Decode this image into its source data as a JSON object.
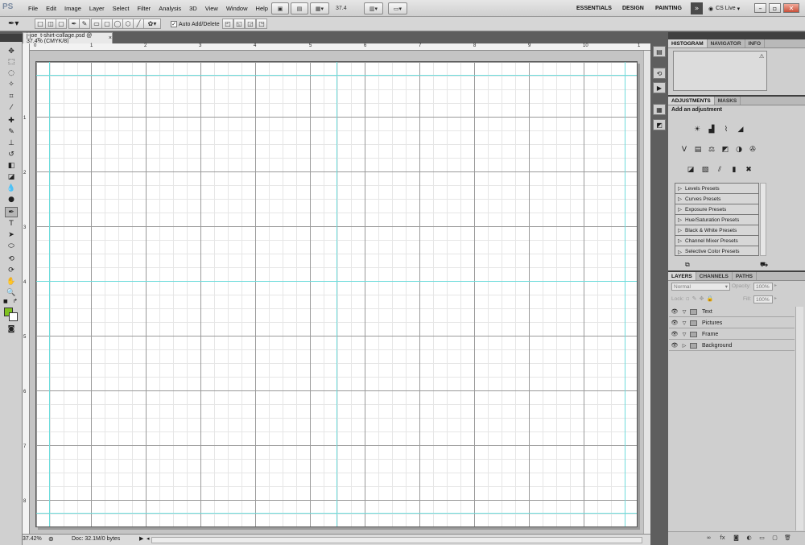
{
  "app": {
    "logo": "PS"
  },
  "menu": [
    "File",
    "Edit",
    "Image",
    "Layer",
    "Select",
    "Filter",
    "Analysis",
    "3D",
    "View",
    "Window",
    "Help"
  ],
  "appbar": {
    "zoom": "37.4",
    "workspaces": [
      "ESSENTIALS",
      "DESIGN",
      "PAINTING"
    ],
    "cs_live": "CS Live"
  },
  "options": {
    "auto_add_delete": "Auto Add/Delete",
    "auto_add_checked": "✓"
  },
  "document": {
    "tab_title": "j-joe_t-shirt-collage.psd @ 37.4% (CMYK/8)",
    "ruler_top": [
      "0",
      "1",
      "2",
      "3",
      "4",
      "5",
      "6",
      "7",
      "8",
      "9",
      "10",
      "1"
    ],
    "ruler_left": [
      "1",
      "2",
      "3",
      "4",
      "5",
      "6",
      "7",
      "8"
    ]
  },
  "status": {
    "zoom": "37.42%",
    "doc_size": "Doc: 32.1M/0 bytes"
  },
  "panels": {
    "histogram_tabs": [
      "HISTOGRAM",
      "NAVIGATOR",
      "INFO"
    ],
    "adjustment_tabs": [
      "ADJUSTMENTS",
      "MASKS"
    ],
    "add_adjustment": "Add an adjustment",
    "presets": [
      "Levels Presets",
      "Curves Presets",
      "Exposure Presets",
      "Hue/Saturation Presets",
      "Black & White Presets",
      "Channel Mixer Presets",
      "Selective Color Presets"
    ],
    "layers_tabs": [
      "LAYERS",
      "CHANNELS",
      "PATHS"
    ],
    "blend_mode": "Normal",
    "opacity_label": "Opacity:",
    "opacity_value": "100%",
    "lock_label": "Lock:",
    "fill_label": "Fill:",
    "fill_value": "100%",
    "layers": [
      {
        "name": "Text",
        "expanded": true
      },
      {
        "name": "Pictures",
        "expanded": true
      },
      {
        "name": "Frame",
        "expanded": true
      },
      {
        "name": "Background",
        "expanded": false
      }
    ]
  },
  "colors": {
    "foreground": "#7fc21f",
    "background": "#ffffff",
    "guide": "#6fdcdc"
  }
}
